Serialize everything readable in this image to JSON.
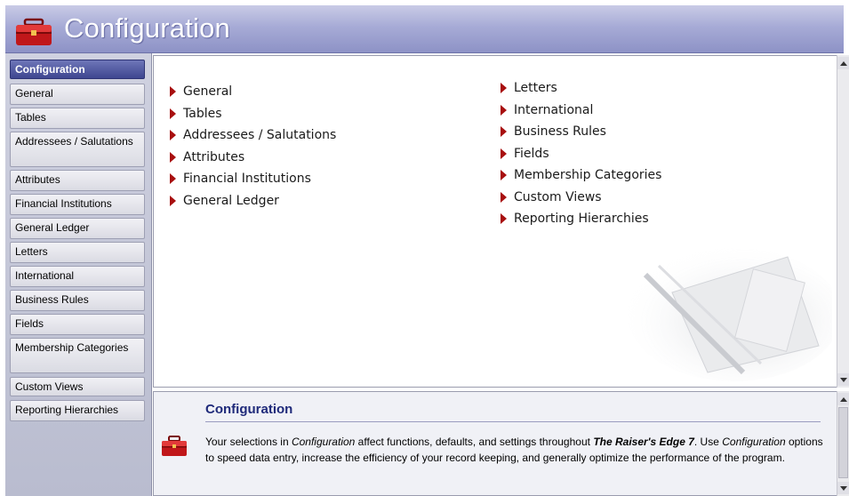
{
  "window": {
    "title": "Configuration"
  },
  "sidebar": {
    "items": [
      {
        "label": "Configuration",
        "active": true
      },
      {
        "label": "General"
      },
      {
        "label": "Tables"
      },
      {
        "label": "Addressees / Salutations"
      },
      {
        "label": "Attributes"
      },
      {
        "label": "Financial Institutions"
      },
      {
        "label": "General Ledger"
      },
      {
        "label": "Letters"
      },
      {
        "label": "International"
      },
      {
        "label": "Business Rules"
      },
      {
        "label": "Fields"
      },
      {
        "label": "Membership Categories"
      },
      {
        "label": "Custom Views"
      },
      {
        "label": "Reporting Hierarchies"
      }
    ]
  },
  "links": {
    "left": [
      "General",
      "Tables",
      "Addressees / Salutations",
      "Attributes",
      "Financial Institutions",
      "General Ledger"
    ],
    "right": [
      "Letters",
      "International",
      "Business Rules",
      "Fields",
      "Membership Categories",
      "Custom Views",
      "Reporting Hierarchies"
    ]
  },
  "description": {
    "title": "Configuration",
    "text_1": "Your selections in ",
    "em_1": "Configuration",
    "text_2": " affect functions, defaults, and settings throughout ",
    "strong_1": "The Raiser's Edge 7",
    "text_3": ". Use ",
    "em_2": "Configuration",
    "text_4": " options to speed data entry, increase the efficiency of your record keeping, and generally optimize the performance of the program."
  },
  "icons": {
    "title": "toolbox-icon",
    "bullet": "arrow-right-icon",
    "scroll_up": "scroll-up-icon",
    "scroll_down": "scroll-down-icon"
  },
  "colors": {
    "accent": "#3e4690",
    "bullet": "#a80f0f",
    "desc_title": "#1f2a7a"
  }
}
